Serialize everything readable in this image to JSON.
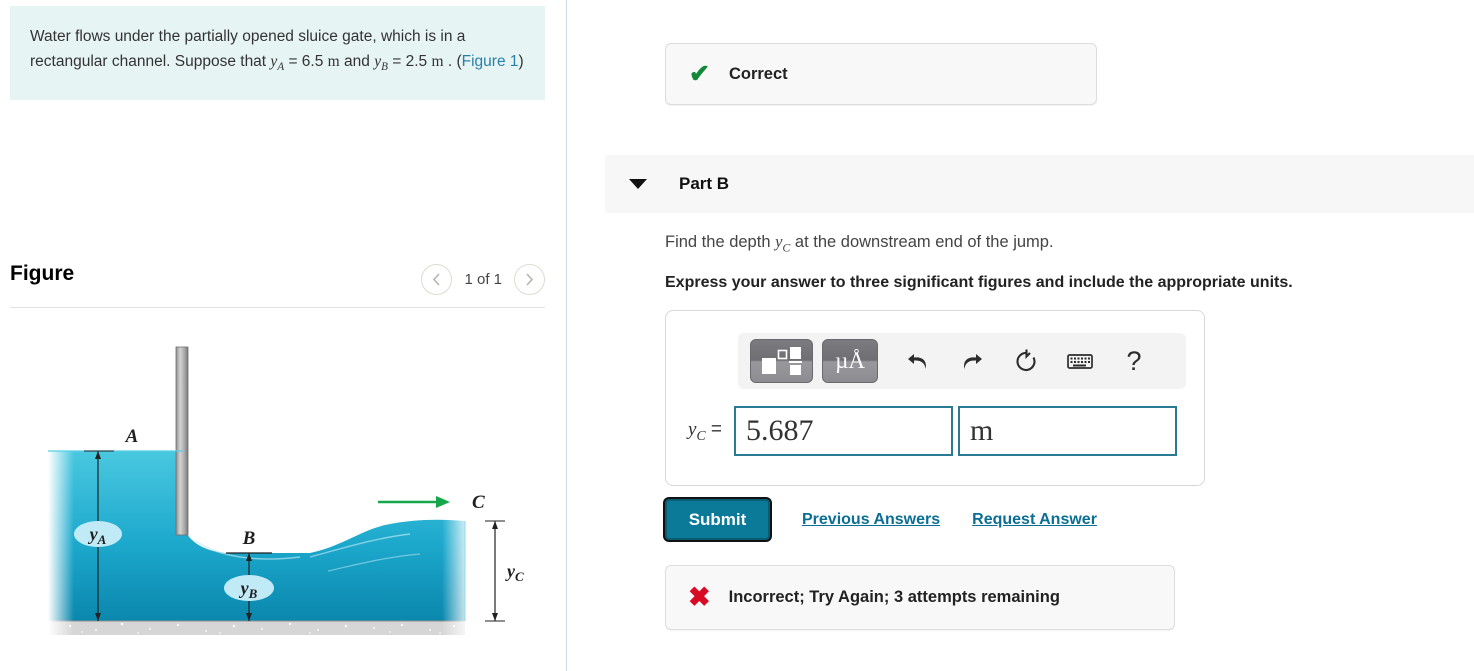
{
  "problem": {
    "text_part1": "Water flows under the partially opened sluice gate, which is in a rectangular channel. Suppose that ",
    "var_a": "y",
    "var_a_sub": "A",
    "eq_a": " = 6.5 ",
    "unit_a": "m",
    "text_part2": " and ",
    "var_b": "y",
    "var_b_sub": "B",
    "eq_b": " = 2.5 ",
    "unit_b": "m",
    "text_part3": " . (",
    "figure_link": "Figure 1",
    "text_part4": ")"
  },
  "figure": {
    "title": "Figure",
    "count_label": "1 of 1",
    "prev_icon": "chevron-left-icon",
    "next_icon": "chevron-right-icon",
    "labels": {
      "point_a": "A",
      "point_b": "B",
      "point_c": "C",
      "depth_a": "y",
      "depth_a_sub": "A",
      "depth_b": "y",
      "depth_b_sub": "B",
      "depth_c": "y",
      "depth_c_sub": "C"
    },
    "colors": {
      "water_top": "#3fc3dd",
      "water_bottom": "#0e8fb8",
      "bed": "#d4d4d4",
      "gate": "#a8a8a8",
      "flow_arrow": "#14a84a",
      "label_pill": "#bfe9f5"
    }
  },
  "feedback_top": {
    "icon": "check-icon",
    "label": "Correct",
    "color": "#13883b"
  },
  "part": {
    "caret_icon": "caret-down-icon",
    "label": "Part B",
    "question_prefix": "Find the depth ",
    "question_var": "y",
    "question_var_sub": "C",
    "question_suffix": " at the downstream end of the jump.",
    "instruction": "Express your answer to three significant figures and include the appropriate units."
  },
  "toolbar": {
    "template_icon": "math-template-icon",
    "units_label": "µÅ",
    "undo_icon": "undo-icon",
    "redo_icon": "redo-icon",
    "reset_icon": "reset-icon",
    "keyboard_icon": "keyboard-icon",
    "help_label": "?"
  },
  "answer": {
    "label_var": "y",
    "label_sub": "C",
    "label_eq": " =",
    "value": "5.687",
    "value_placeholder": "",
    "unit": "m",
    "unit_placeholder": "",
    "border_color": "#2a7a94"
  },
  "actions": {
    "submit_label": "Submit",
    "previous_answers_label": "Previous Answers",
    "request_answer_label": "Request Answer",
    "submit_color": "#0b7a99",
    "link_color": "#0b6e94"
  },
  "feedback_bottom": {
    "icon": "cross-icon",
    "label": "Incorrect; Try Again; 3 attempts remaining",
    "color": "#d80b24"
  }
}
